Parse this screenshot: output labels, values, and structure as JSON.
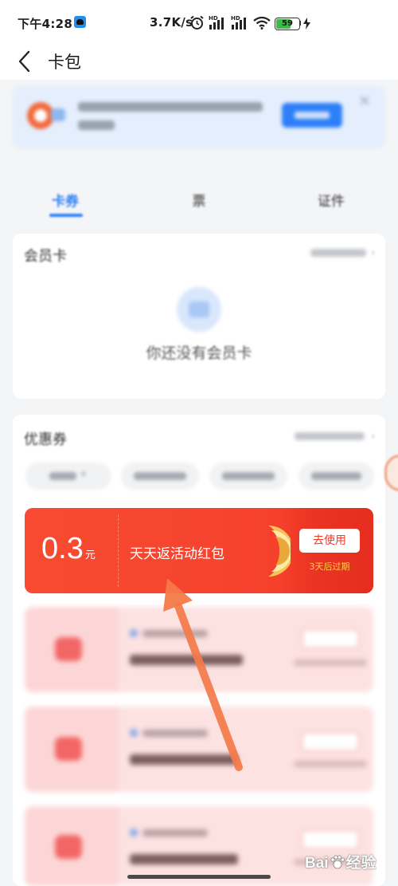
{
  "status_bar": {
    "time": "下午4:28",
    "net_speed": "3.7K/s",
    "hd_label": "HD",
    "battery": "59",
    "icons": [
      "app-notification-icon",
      "alarm-icon",
      "signal-icon",
      "signal-icon",
      "wifi-icon",
      "battery-icon",
      "charging-icon"
    ]
  },
  "header": {
    "title": "卡包",
    "back_icon": "back-arrow-icon"
  },
  "banner": {
    "icon": "app-logo-icon",
    "close_icon": "close-icon"
  },
  "tabs": [
    {
      "label": "卡券",
      "active": true
    },
    {
      "label": "票",
      "active": false
    },
    {
      "label": "证件",
      "active": false
    }
  ],
  "membership": {
    "title": "会员卡",
    "empty_icon": "card-icon",
    "empty_text": "你还没有会员卡"
  },
  "coupons": {
    "title": "优惠券",
    "featured": {
      "amount": "0.3",
      "unit": "元",
      "name": "天天返活动红包",
      "action": "去使用",
      "expiry": "3天后过期"
    },
    "item_icon": "red-packet-icon"
  },
  "watermark": {
    "left": "Bai",
    "right": "经验",
    "logo": "paw-logo-icon"
  },
  "colors": {
    "accent": "#2d7ff7",
    "coupon_red": "#f6432e",
    "expiry_yellow": "#ffd346",
    "arrow_orange": "#f47a4a",
    "banner_bg": "#e4eefc"
  }
}
